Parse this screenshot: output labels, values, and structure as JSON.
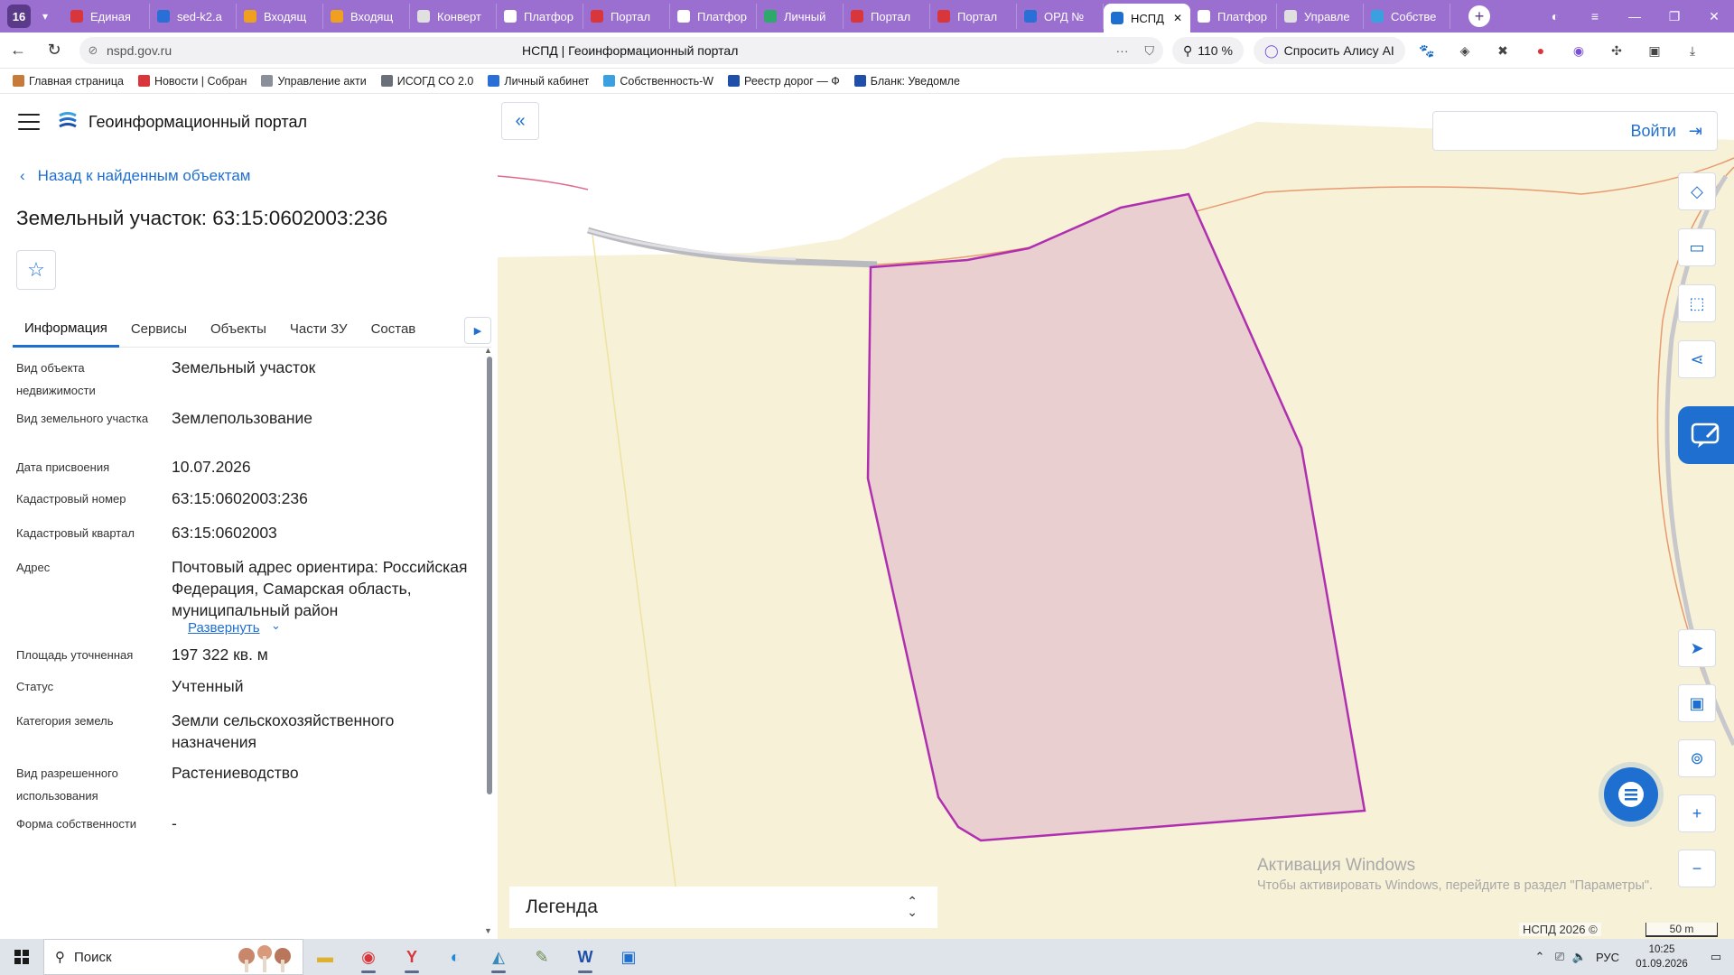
{
  "browser": {
    "tab_count": "16",
    "tabs": [
      {
        "label": "Единая",
        "color": "#d8363a"
      },
      {
        "label": "sed-k2.a",
        "color": "#2a6fd6"
      },
      {
        "label": "Входящ",
        "color": "#f0a020"
      },
      {
        "label": "Входящ",
        "color": "#f0a020"
      },
      {
        "label": "Конверт",
        "color": "#e0e0e0"
      },
      {
        "label": "Платфор",
        "color": "#ffffff"
      },
      {
        "label": "Портал",
        "color": "#d8363a"
      },
      {
        "label": "Платфор",
        "color": "#ffffff"
      },
      {
        "label": "Личный",
        "color": "#2fa86b"
      },
      {
        "label": "Портал",
        "color": "#d8363a"
      },
      {
        "label": "Портал",
        "color": "#d8363a"
      },
      {
        "label": "ОРД №",
        "color": "#2a6fd6"
      },
      {
        "label": "НСПД",
        "color": "#1f6fd1",
        "active": true
      },
      {
        "label": "Платфор",
        "color": "#ffffff"
      },
      {
        "label": "Управле",
        "color": "#e0e0e0"
      },
      {
        "label": "Собстве",
        "color": "#3aa0e0"
      }
    ],
    "address": {
      "domain": "nspd.gov.ru",
      "page_title": "НСПД | Геоинформационный портал",
      "zoom": "110 %",
      "alice_label": "Спросить Алису AI"
    },
    "bookmarks": [
      {
        "label": "Главная страница",
        "color": "#c77b3a"
      },
      {
        "label": "Новости | Собран",
        "color": "#d8363a"
      },
      {
        "label": "Управление акти",
        "color": "#8a8f99"
      },
      {
        "label": "ИСОГД СО 2.0",
        "color": "#6a6f79"
      },
      {
        "label": "Личный кабинет",
        "color": "#2a6fd6"
      },
      {
        "label": "Собственность-W",
        "color": "#3aa0e0"
      },
      {
        "label": "Реестр дорог — Ф",
        "color": "#1f4fa8"
      },
      {
        "label": "Бланк: Уведомле",
        "color": "#1f4fa8"
      }
    ]
  },
  "panel": {
    "portal_title": "Геоинформационный портал",
    "back_label": "Назад к найденным объектам",
    "object_title": "Земельный участок: 63:15:0602003:236",
    "tabs": [
      "Информация",
      "Сервисы",
      "Объекты",
      "Части ЗУ",
      "Состав"
    ],
    "rows": [
      {
        "label": "Вид объекта недвижимости",
        "value": "Земельный участок"
      },
      {
        "label": "Вид земельного участка",
        "value": "Землепользование"
      },
      {
        "label": "Дата присвоения",
        "value": "10.07.2026"
      },
      {
        "label": "Кадастровый номер",
        "value": "63:15:0602003:236"
      },
      {
        "label": "Кадастровый квартал",
        "value": "63:15:0602003"
      },
      {
        "label": "Адрес",
        "value": "Почтовый адрес ориентира: Российская Федерация, Самарская область, муниципальный район"
      },
      {
        "label": "Площадь уточненная",
        "value": "197 322 кв. м"
      },
      {
        "label": "Статус",
        "value": "Учтенный"
      },
      {
        "label": "Категория земель",
        "value": "Земли сельскохозяйственного назначения"
      },
      {
        "label": "Вид разрешенного использования",
        "value": "Растениеводство"
      },
      {
        "label": "Форма собственности",
        "value": "-"
      }
    ],
    "expand_label": "Развернуть"
  },
  "map": {
    "login_label": "Войти",
    "legend_label": "Легенда",
    "watermark_title": "Активация Windows",
    "watermark_sub": "Чтобы активировать Windows, перейдите в раздел \"Параметры\".",
    "copyright": "НСПД 2026 ©",
    "scale": "50 m",
    "parcel_fill": "#e9cfcf",
    "parcel_stroke": "#b02fb0",
    "background": "#f6f1d7"
  },
  "taskbar": {
    "search_label": "Поиск",
    "lang": "РУС",
    "time": "10:25",
    "date": "01.09.2026"
  }
}
